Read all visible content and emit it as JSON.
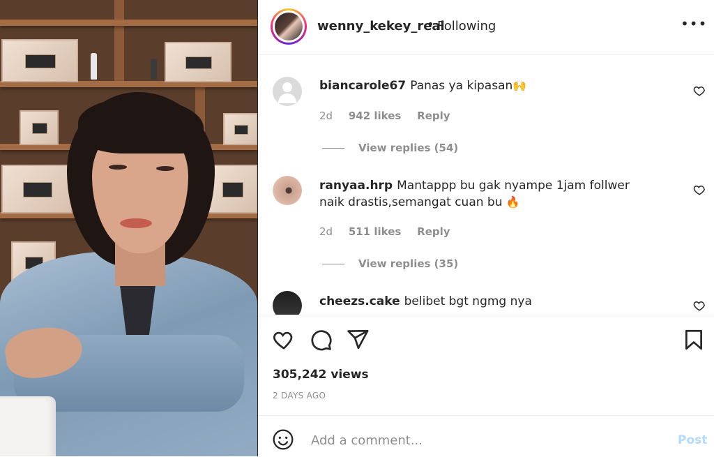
{
  "header": {
    "username": "wenny_kekey_real",
    "separator": "•",
    "follow_status": "Following",
    "more_label": "•••"
  },
  "comments": [
    {
      "username": "biancarole67",
      "text": "Panas ya kipasan",
      "emoji": "🙌",
      "age": "2d",
      "likes": "942 likes",
      "reply_label": "Reply",
      "view_replies": "View replies (54)"
    },
    {
      "username": "ranyaa.hrp",
      "text": "Mantappp bu gak nyampe 1jam follwer naik drastis,semangat cuan bu",
      "emoji": "🔥",
      "age": "2d",
      "likes": "511 likes",
      "reply_label": "Reply",
      "view_replies": "View replies (35)"
    },
    {
      "username": "cheezs.cake",
      "text": "belibet bgt ngmg nya"
    }
  ],
  "post": {
    "views": "305,242 views",
    "posted_ago": "2 DAYS AGO"
  },
  "composer": {
    "placeholder": "Add a comment...",
    "post_label": "Post"
  },
  "icons": {
    "like": "heart-icon",
    "comment": "comment-bubble-icon",
    "share": "paper-plane-icon",
    "save": "bookmark-icon",
    "emoji": "smiley-icon",
    "more": "more-options-icon"
  },
  "colors": {
    "text": "#262626",
    "secondary": "#8e8e8e",
    "post_disabled": "#b3dbff"
  }
}
